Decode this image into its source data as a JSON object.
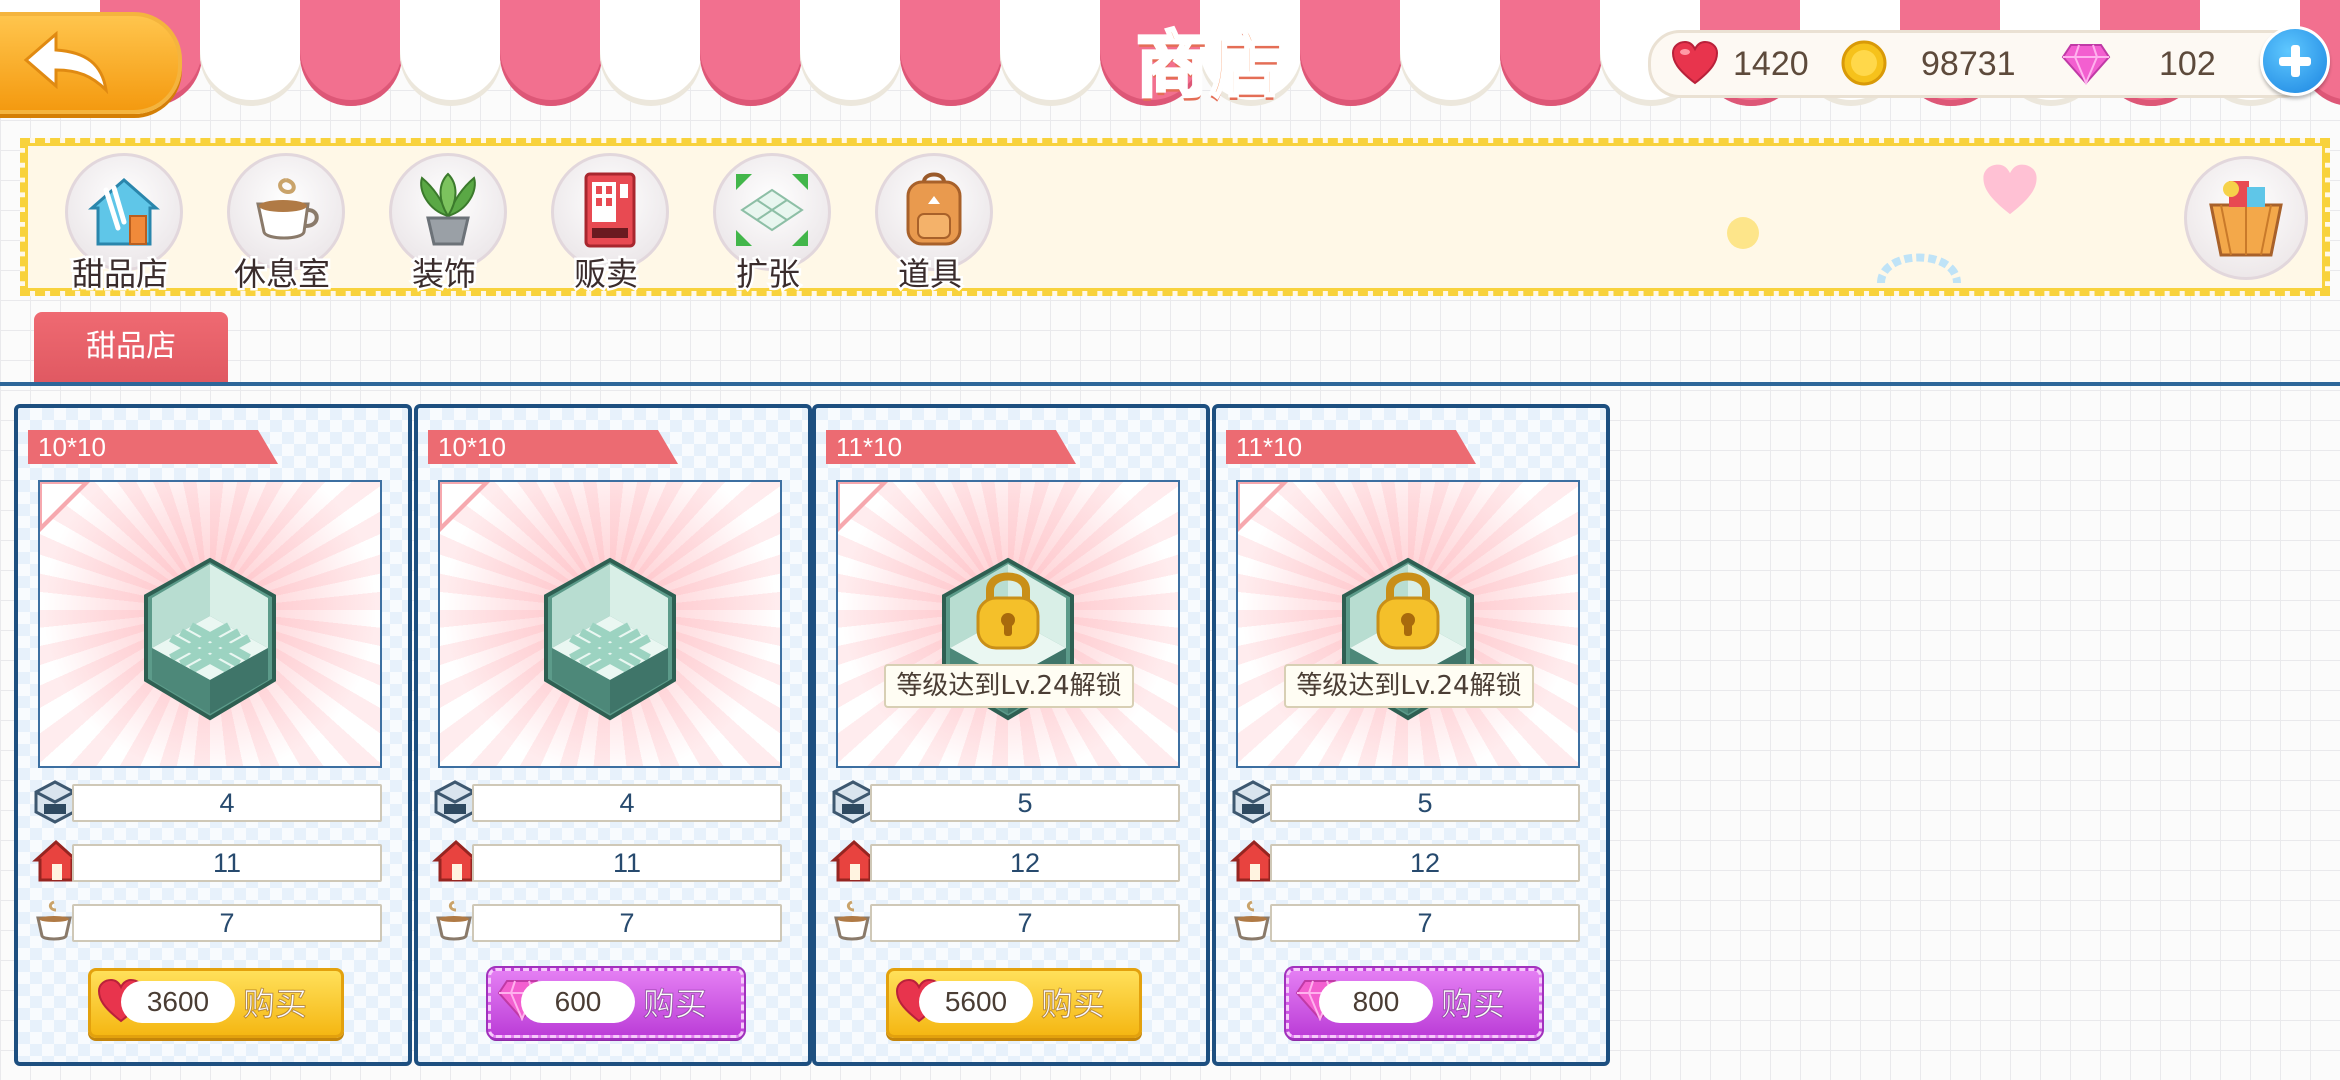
{
  "header": {
    "title": "商店",
    "back_icon": "back-arrow-icon",
    "currencies": [
      {
        "name": "hearts",
        "icon": "heart-icon",
        "value": "1420"
      },
      {
        "name": "coins",
        "icon": "coin-icon",
        "value": "98731"
      },
      {
        "name": "gems",
        "icon": "gem-icon",
        "value": "102"
      }
    ],
    "add_icon": "plus-icon"
  },
  "categories": [
    {
      "label": "甜品店",
      "icon": "dessert-shop-icon"
    },
    {
      "label": "休息室",
      "icon": "coffee-cup-icon"
    },
    {
      "label": "装饰",
      "icon": "potted-plant-icon"
    },
    {
      "label": "贩卖",
      "icon": "vending-machine-icon"
    },
    {
      "label": "扩张",
      "icon": "expand-floor-icon"
    },
    {
      "label": "道具",
      "icon": "backpack-icon"
    }
  ],
  "basket_icon": "gift-basket-icon",
  "active_tab": "甜品店",
  "cards": [
    {
      "size": "10*10",
      "locked": false,
      "lock_text": "",
      "stat_floor": "4",
      "stat_shop": "11",
      "stat_lounge": "7",
      "currency": "heart",
      "price": "3600",
      "buy_label": "购买"
    },
    {
      "size": "10*10",
      "locked": false,
      "lock_text": "",
      "stat_floor": "4",
      "stat_shop": "11",
      "stat_lounge": "7",
      "currency": "gem",
      "price": "600",
      "buy_label": "购买"
    },
    {
      "size": "11*10",
      "locked": true,
      "lock_text": "等级达到Lv.24解锁",
      "stat_floor": "5",
      "stat_shop": "12",
      "stat_lounge": "7",
      "currency": "heart",
      "price": "5600",
      "buy_label": "购买"
    },
    {
      "size": "11*10",
      "locked": true,
      "lock_text": "等级达到Lv.24解锁",
      "stat_floor": "5",
      "stat_shop": "12",
      "stat_lounge": "7",
      "currency": "gem",
      "price": "800",
      "buy_label": "购买"
    }
  ],
  "colors": {
    "accent_pink": "#f2708f",
    "tab_red": "#e05962",
    "frame_blue": "#1d4f80",
    "gold": "#f5b713",
    "purple": "#bc3ed8"
  }
}
